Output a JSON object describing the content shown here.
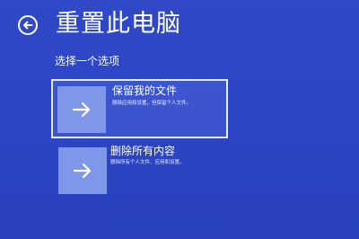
{
  "page": {
    "title": "重置此电脑",
    "subtitle": "选择一个选项"
  },
  "icons": {
    "back": "back-arrow-circle-icon",
    "option": "arrow-right-icon"
  },
  "options": [
    {
      "title": "保留我的文件",
      "description": "删除应用和设置，但保留个人文件。"
    },
    {
      "title": "删除所有内容",
      "description": "删除所有个人文件、应用和设置。"
    }
  ],
  "colors": {
    "background": "#2f49c9",
    "tile": "#7f97e9",
    "selected_border": "#e6ebff"
  }
}
